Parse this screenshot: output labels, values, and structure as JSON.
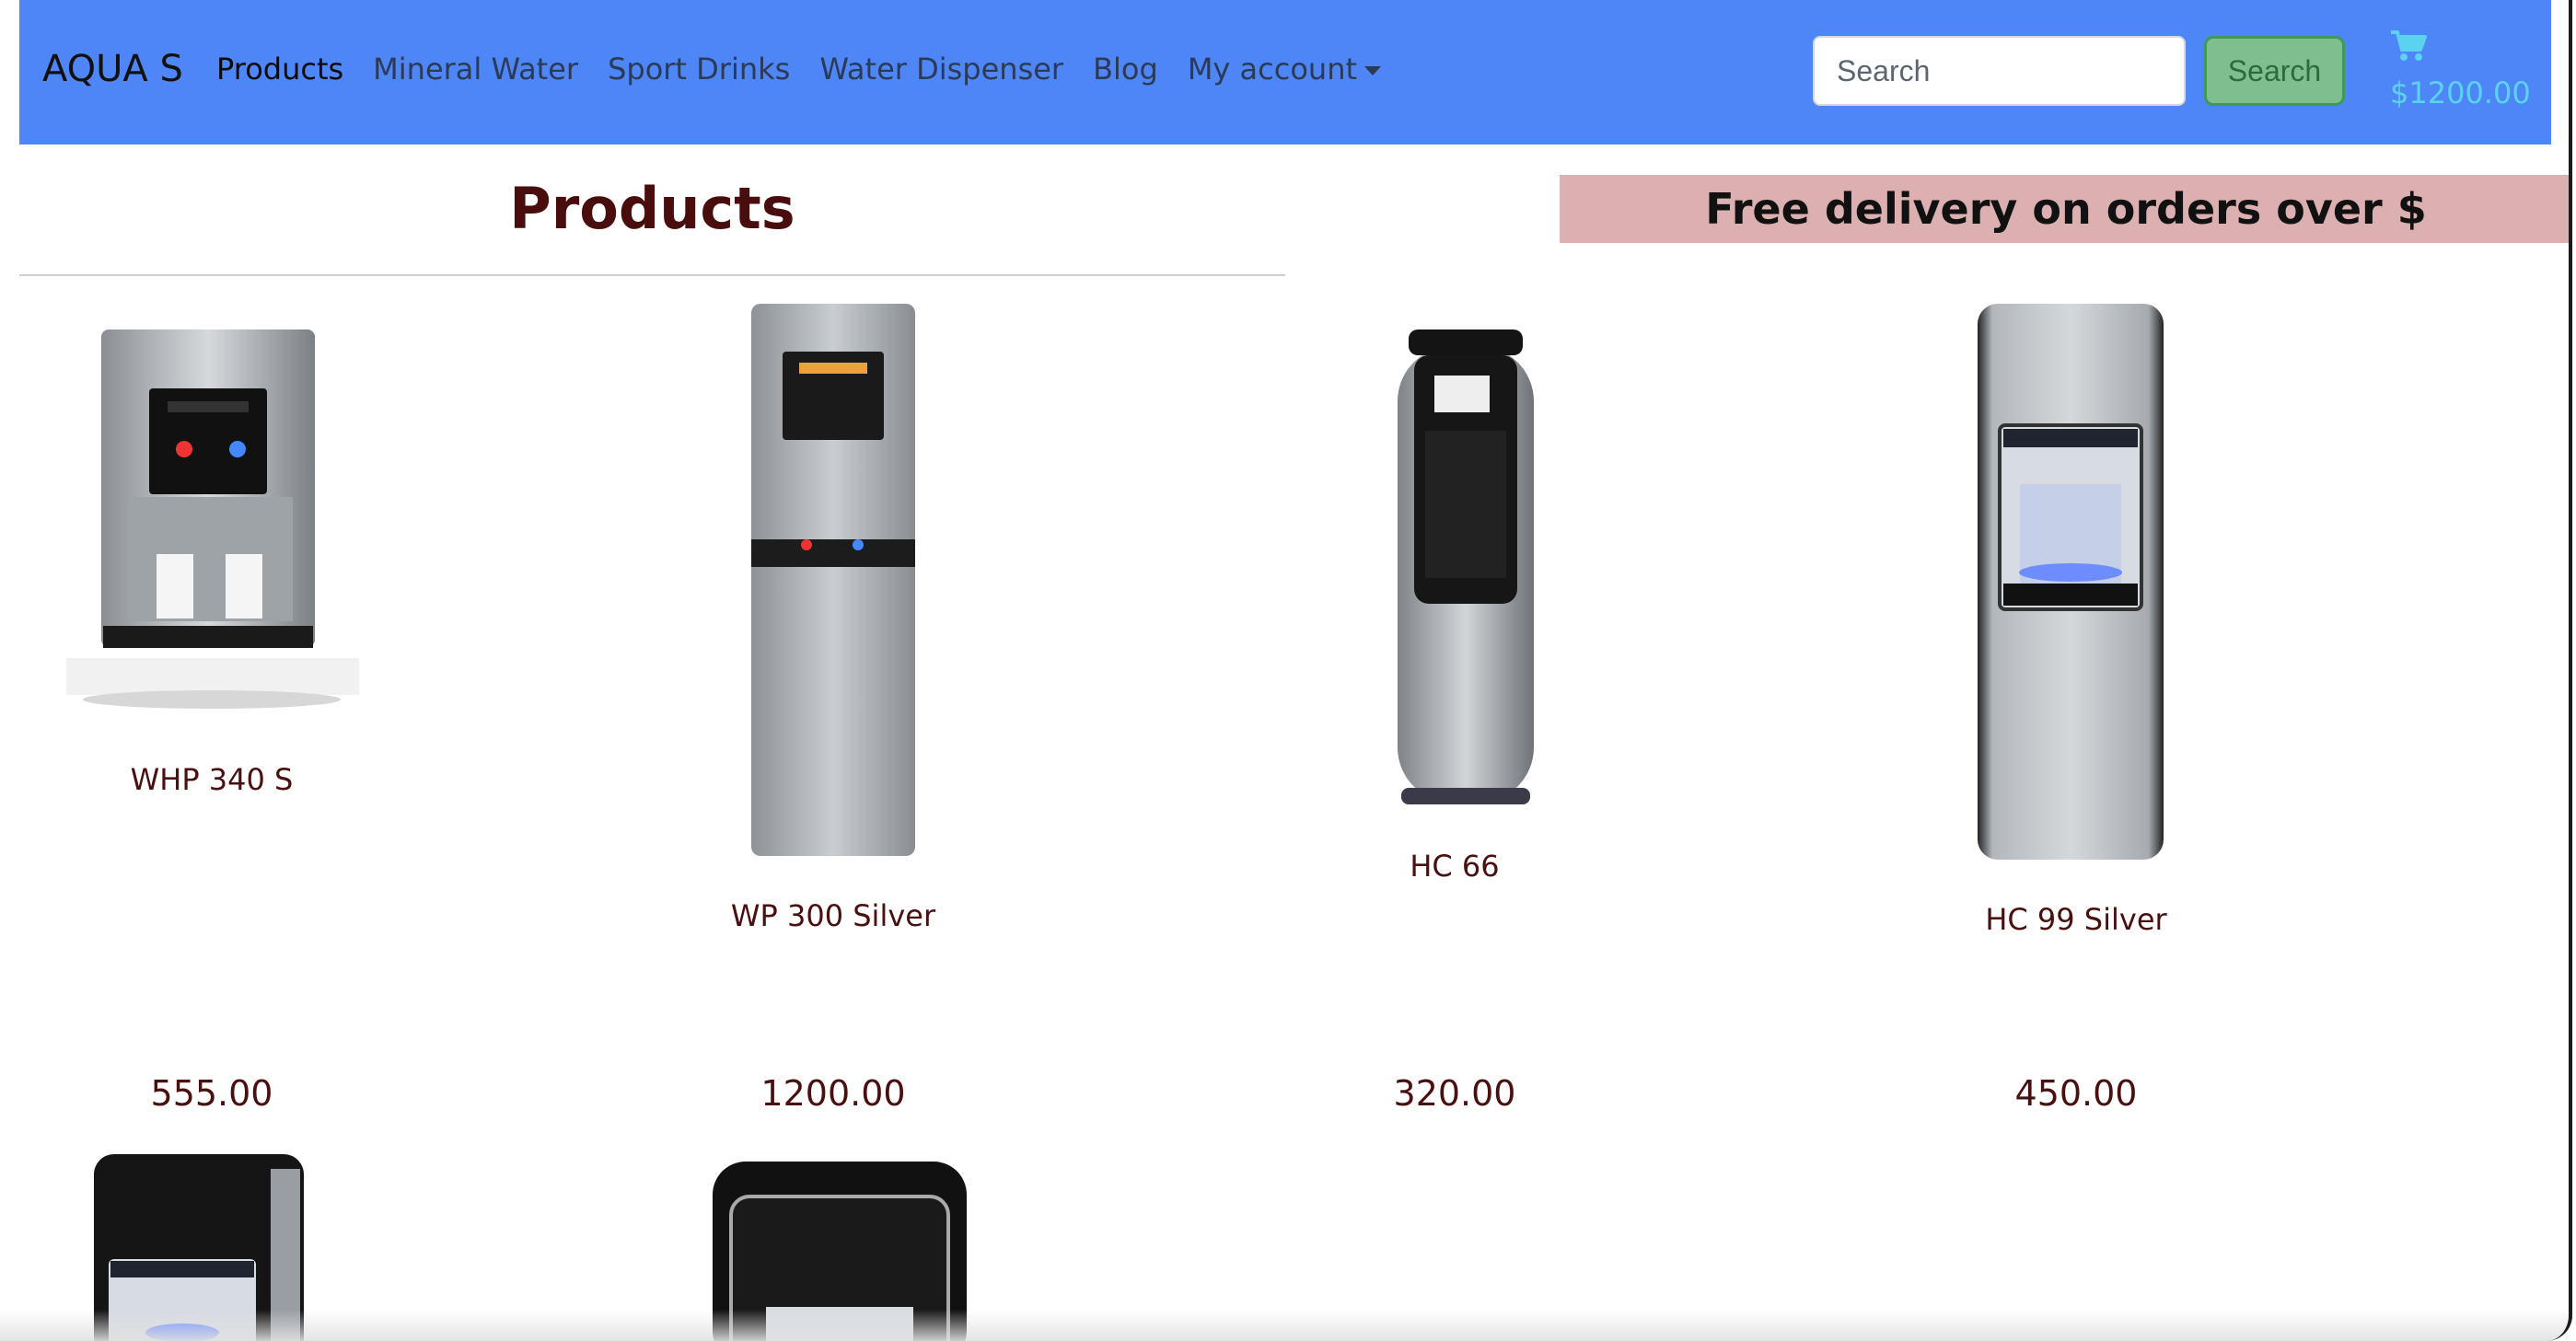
{
  "navbar": {
    "brand": "AQUA S",
    "links": [
      "Products",
      "Mineral Water",
      "Sport Drinks",
      "Water Dispenser",
      "Blog",
      "My account"
    ],
    "search_placeholder": "Search",
    "search_button": "Search",
    "cart_total": "$1200.00"
  },
  "main": {
    "title": "Products",
    "promo": "Free delivery on orders over $"
  },
  "products": [
    {
      "name": "WHP 340 S",
      "price": "555.00"
    },
    {
      "name": "WP 300 Silver",
      "price": "1200.00"
    },
    {
      "name": "HC 66",
      "price": "320.00"
    },
    {
      "name": "HC 99 Silver",
      "price": "450.00"
    }
  ],
  "colors": {
    "navbar": "#4f86f7",
    "promo_background": "#dcb0b1",
    "text_dark_red": "#4a0d0d",
    "cart": "#5ad2f0",
    "search_button": "#7fbf8f"
  },
  "icons": [
    "cart-icon",
    "chevron-down-icon"
  ]
}
